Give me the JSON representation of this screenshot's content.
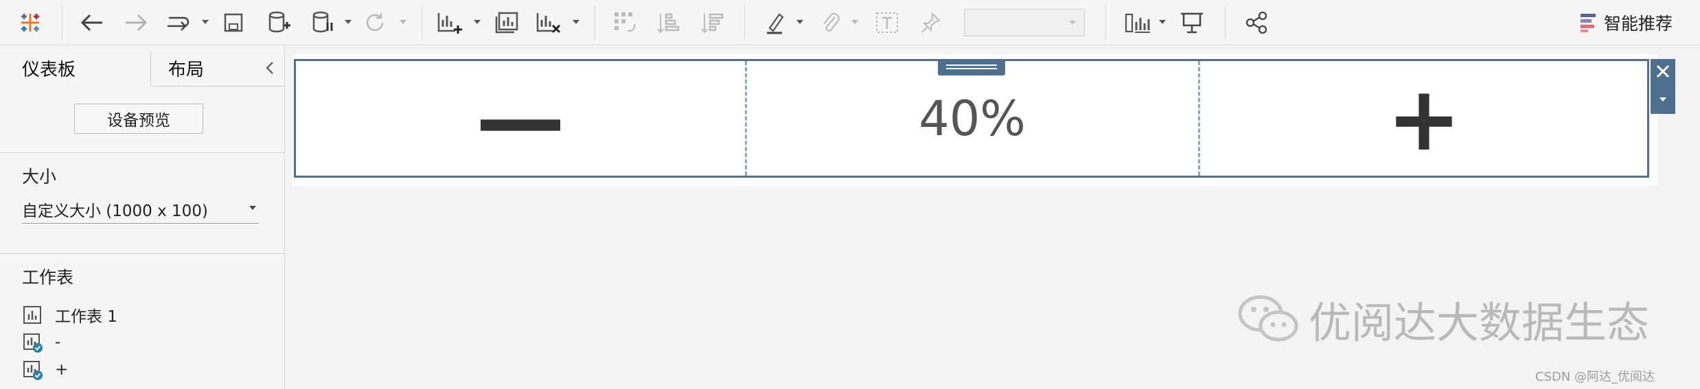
{
  "toolbar": {
    "ai_recommend_label": "智能推荐",
    "icons": [
      "tableau-logo-icon",
      "back-icon",
      "forward-icon",
      "redo-icon",
      "save-icon",
      "new-datasource-icon",
      "pause-datasource-icon",
      "refresh-icon",
      "new-worksheet-icon",
      "new-dashboard-icon",
      "clear-sheet-icon",
      "swap-icon",
      "sort-asc-icon",
      "sort-desc-icon",
      "highlight-icon",
      "attach-icon",
      "text-icon",
      "pin-icon",
      "show-me-icon",
      "presentation-icon",
      "share-icon"
    ]
  },
  "left_panel": {
    "tabs": [
      "仪表板",
      "布局"
    ],
    "device_preview_label": "设备预览",
    "size_title": "大小",
    "size_value": "自定义大小 (1000 x 100)",
    "sheets_title": "工作表",
    "sheets": [
      {
        "label": "工作表 1"
      },
      {
        "label": "-"
      },
      {
        "label": "+"
      }
    ]
  },
  "dashboard": {
    "minus_label": "—",
    "percent_label": "40%",
    "plus_label": "+"
  },
  "watermark": {
    "text": "优阅达大数据生态",
    "csdn": "CSDN @阿达_优阅达"
  },
  "colors": {
    "frame": "#4f6f8f",
    "dashed": "#8aa7c7"
  }
}
